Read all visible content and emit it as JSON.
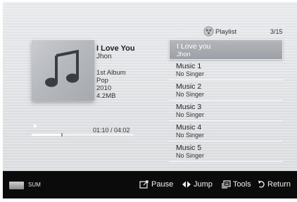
{
  "song": {
    "title": "I Love You",
    "artist": "Jhon",
    "album": "1st Album",
    "genre": "Pop",
    "year": "2010",
    "size": "4.2MB"
  },
  "player": {
    "time": "01:10 / 04:02",
    "progress_fraction": 0.29
  },
  "playlist": {
    "label": "Playlist",
    "count": "3/15",
    "items": [
      {
        "title": "I Love you",
        "artist": "Jhon",
        "selected": true
      },
      {
        "title": "Music 1",
        "artist": "No Singer"
      },
      {
        "title": "Music 2",
        "artist": "No Singer"
      },
      {
        "title": "Music 3",
        "artist": "No Singer"
      },
      {
        "title": "Music 4",
        "artist": "No Singer"
      },
      {
        "title": "Music 5",
        "artist": "No Singer"
      }
    ]
  },
  "bottom_bar": {
    "device_label": "SUM",
    "device_icon": "usb-device-icon",
    "controls": [
      {
        "label": "Pause",
        "icon": "pause-icon"
      },
      {
        "label": "Jump",
        "icon": "jump-icon"
      },
      {
        "label": "Tools",
        "icon": "tools-icon"
      },
      {
        "label": "Return",
        "icon": "return-icon"
      }
    ]
  },
  "colors": {
    "background": "#e2e4e7",
    "selected_item": "#a8abb0",
    "bottom_bar": "#0b0b0b"
  }
}
